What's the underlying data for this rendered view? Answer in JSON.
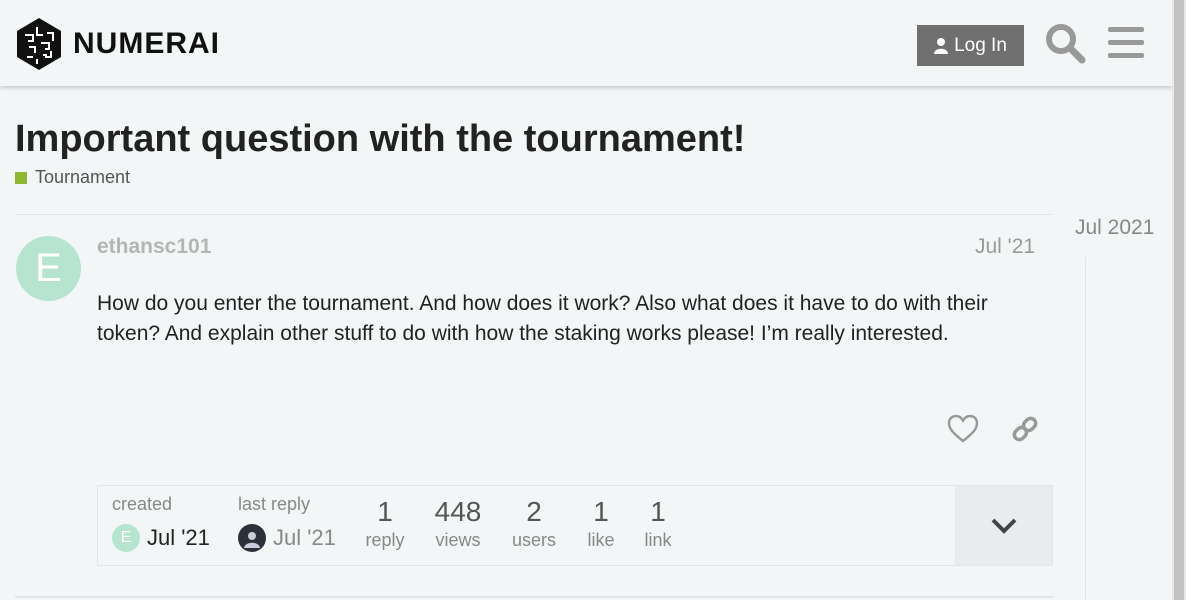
{
  "header": {
    "brand": "NUMERAI",
    "login_label": "Log In"
  },
  "topic": {
    "title": "Important question with the tournament!",
    "category": "Tournament",
    "category_color": "#8fb832"
  },
  "post": {
    "avatar_letter": "E",
    "username": "ethansc101",
    "date": "Jul '21",
    "body": "How do you enter the tournament. And how does it work? Also what does it have to do with their token? And explain other stuff to do with how the staking works please! I’m really interested."
  },
  "topic_map": {
    "created_label": "created",
    "created_avatar": "E",
    "created_date": "Jul '21",
    "last_reply_label": "last reply",
    "last_reply_date": "Jul '21",
    "stats": [
      {
        "num": "1",
        "label": "reply"
      },
      {
        "num": "448",
        "label": "views"
      },
      {
        "num": "2",
        "label": "users"
      },
      {
        "num": "1",
        "label": "like"
      },
      {
        "num": "1",
        "label": "link"
      }
    ]
  },
  "timeline": {
    "date": "Jul 2021"
  }
}
